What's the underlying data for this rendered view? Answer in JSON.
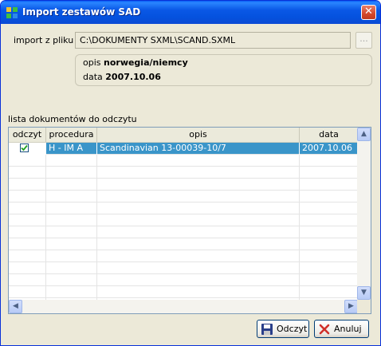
{
  "window": {
    "title": "Import zestawów SAD",
    "close_glyph": "✕"
  },
  "import": {
    "label": "import z pliku",
    "path": "C:\\DOKUMENTY SXML\\SCAND.SXML",
    "browse_label": "..."
  },
  "info": {
    "opis_label": "opis",
    "opis_value": "norwegia/niemcy",
    "data_label": "data",
    "data_value": "2007.10.06"
  },
  "list": {
    "label": "lista dokumentów do odczytu",
    "columns": [
      "odczyt",
      "procedura",
      "opis",
      "data"
    ],
    "rows": [
      {
        "checked": true,
        "procedura": "H - IM A",
        "opis": "Scandinavian 13-00039-10/7",
        "data": "2007.10.06"
      }
    ],
    "empty_rows": 13
  },
  "buttons": {
    "read_label": "Odczyt",
    "cancel_label": "Anuluj"
  },
  "colors": {
    "titlebar": "#0a58e6",
    "selection": "#3a95c9",
    "dialog_bg": "#ece9d8"
  },
  "icons": [
    "app-icon",
    "close-icon",
    "floppy-save-icon",
    "cancel-x-icon",
    "checkmark-icon",
    "scroll-up-icon",
    "scroll-down-icon",
    "scroll-left-icon",
    "scroll-right-icon"
  ]
}
